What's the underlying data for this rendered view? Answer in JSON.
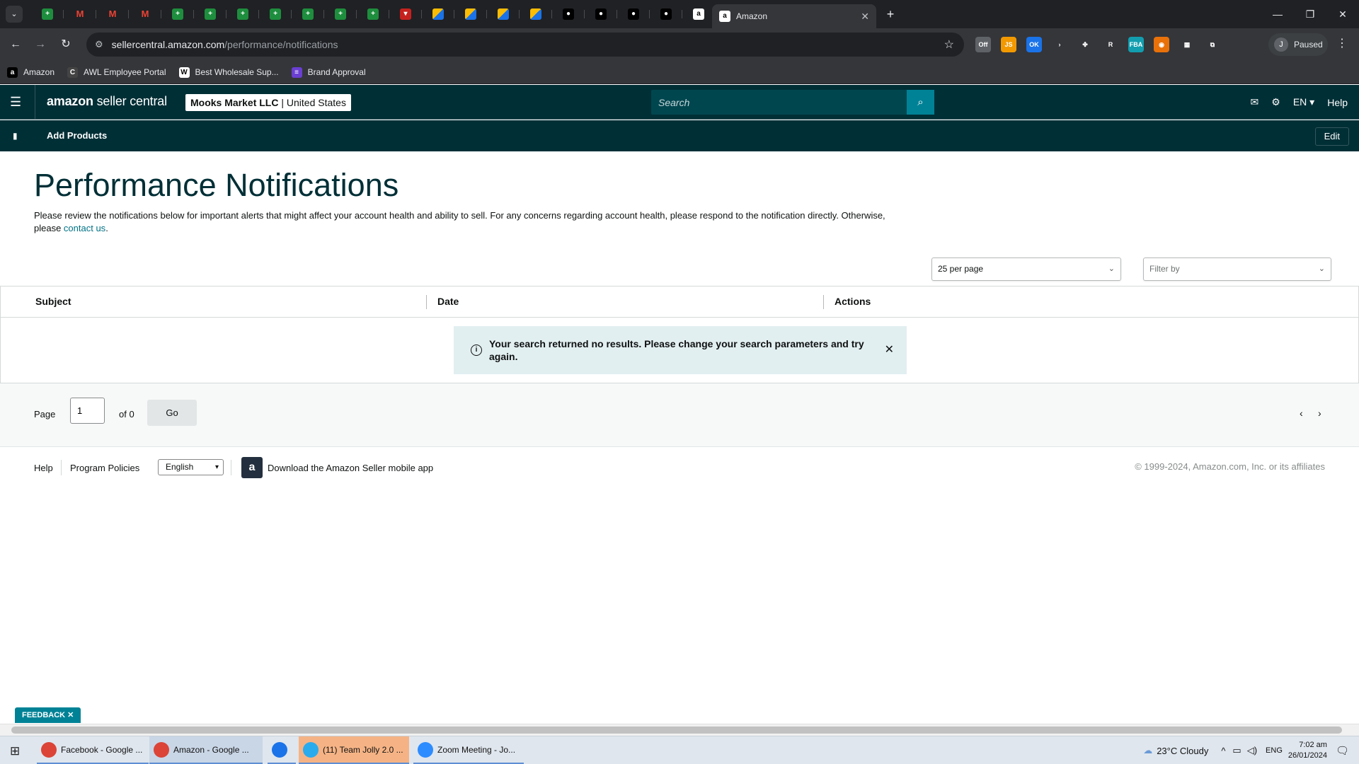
{
  "browser": {
    "pinned_tab_count": 21,
    "active_tab_title": "Amazon",
    "url_host": "sellercentral.amazon.com",
    "url_path": "/performance/notifications",
    "profile_label": "Paused",
    "profile_initial": "J",
    "extensions": [
      {
        "label": "Off",
        "color": "#5f6368"
      },
      {
        "label": "JS",
        "color": "#f29900"
      },
      {
        "label": "OK",
        "color": "#1a73e8"
      },
      {
        "label": "›",
        "color": "#35363a"
      },
      {
        "label": "✤",
        "color": "#35363a"
      },
      {
        "label": "R",
        "color": "#35363a"
      },
      {
        "label": "FBA",
        "color": "#129eaf"
      },
      {
        "label": "◉",
        "color": "#e8710a"
      },
      {
        "label": "▦",
        "color": "#35363a"
      },
      {
        "label": "⧉",
        "color": "#35363a"
      }
    ],
    "bookmarks": [
      {
        "label": "Amazon",
        "icon": "a"
      },
      {
        "label": "AWL Employee Portal",
        "icon": "C"
      },
      {
        "label": "Best Wholesale Sup...",
        "icon": "W"
      },
      {
        "label": "Brand Approval",
        "icon": "≡"
      }
    ]
  },
  "header": {
    "logo_main": "amazon",
    "logo_rest": " seller central",
    "account_name": "Mooks Market LLC",
    "account_region": "United States",
    "search_placeholder": "Search",
    "language": "EN",
    "help": "Help"
  },
  "subnav": {
    "add_products": "Add Products",
    "edit": "Edit"
  },
  "main": {
    "title": "Performance Notifications",
    "description_pre": "Please review the notifications below for important alerts that might affect your account health and ability to sell. For any concerns regarding account health, please respond to the notification directly. Otherwise, please ",
    "contact_link": "contact us",
    "description_post": ".",
    "per_page": "25 per page",
    "filter_placeholder": "Filter by",
    "columns": [
      "Subject",
      "Date",
      "Actions"
    ],
    "empty_message": "Your search returned no results. Please change your search parameters and try again.",
    "pager": {
      "page_label": "Page",
      "current_page": "1",
      "of_label": "of 0",
      "go": "Go"
    }
  },
  "footer": {
    "help": "Help",
    "program_policies": "Program Policies",
    "language": "English",
    "download_app": "Download the Amazon Seller mobile app",
    "copyright": "© 1999-2024, Amazon.com, Inc. or its affiliates"
  },
  "feedback": "FEEDBACK",
  "taskbar": {
    "items": [
      {
        "label": "Facebook - Google ...",
        "color": "#db4437"
      },
      {
        "label": "Amazon - Google ...",
        "color": "#db4437"
      },
      {
        "label": "",
        "color": "#1a73e8"
      },
      {
        "label": "(11) Team Jolly 2.0 ...",
        "color": "#2aabee"
      },
      {
        "label": "Zoom Meeting - Jo...",
        "color": "#2d8cff"
      }
    ],
    "weather": "23°C  Cloudy",
    "lang": "ENG",
    "time": "7:02 am",
    "date": "26/01/2024"
  }
}
